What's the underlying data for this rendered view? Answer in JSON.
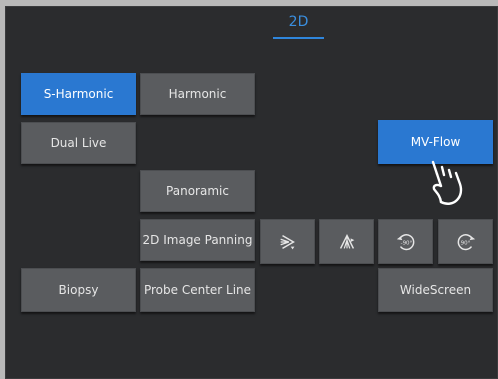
{
  "header": {
    "tab_label": "2D"
  },
  "buttons": {
    "s_harmonic": "S-Harmonic",
    "harmonic": "Harmonic",
    "dual_live": "Dual Live",
    "mv_flow": "MV-Flow",
    "panoramic": "Panoramic",
    "image_panning": "2D Image Panning",
    "biopsy": "Biopsy",
    "probe_center_line": "Probe Center Line",
    "widescreen": "WideScreen"
  },
  "icons": {
    "flip_horizontal": "flip-horizontal-icon",
    "flip_vertical": "flip-vertical-icon",
    "rotate_left": "rotate-minus-90-icon",
    "rotate_right": "rotate-plus-90-icon",
    "rotate_left_label": "-90°",
    "rotate_right_label": "90°"
  },
  "state": {
    "selected": [
      "S-Harmonic",
      "MV-Flow"
    ]
  },
  "colors": {
    "accent": "#2a78d1",
    "button": "#5a5c5f",
    "panel": "#2b2c2e"
  }
}
